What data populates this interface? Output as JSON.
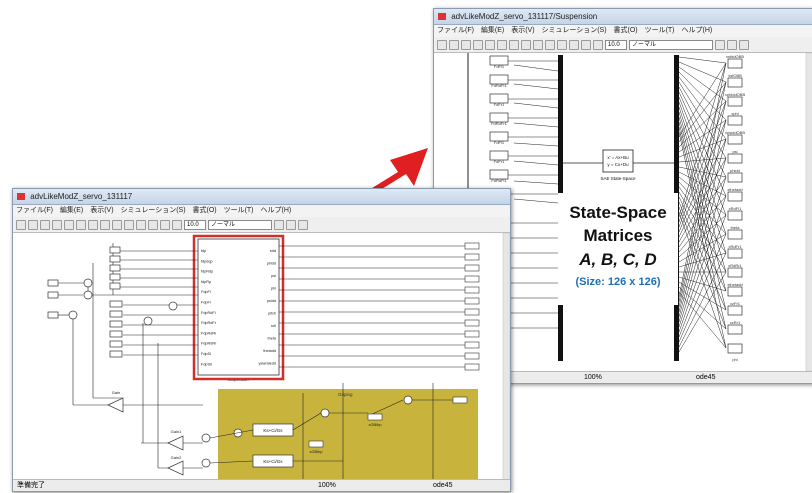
{
  "window_back": {
    "title": "advLikeModZ_servo_131117/Suspension",
    "menu": [
      "ファイル(F)",
      "編集(E)",
      "表示(V)",
      "シミュレーション(S)",
      "書式(O)",
      "ツール(T)",
      "ヘルプ(H)"
    ],
    "sim_time": "10.0",
    "mode": "ノーマル",
    "status_zoom": "100%",
    "status_solver": "ode45",
    "left_blocks": [
      "FdFl1",
      "FdRdFl1",
      "FdFr1",
      "FdRdFr1",
      "FdFl1",
      "FdFr1",
      "FdRdFl1",
      "FdRdFr1"
    ],
    "right_blocks": [
      "xsfddOBB",
      "xsfOBB",
      "xphiddOBB",
      "xphi",
      "xpsiddOBB",
      "psi",
      "phidd",
      "xthetadd",
      "xRdFl1",
      "theta",
      "xRdFr1",
      "xRdRr1",
      "xthetadd",
      "xzFr1",
      "xzRr1",
      "phi"
    ],
    "ss_block_line1": "x' = Ax+Bu",
    "ss_block_line2": "y = Cx+Du",
    "ss_block_caption": "SAE State-Space",
    "callout_title_1": "State-Space",
    "callout_title_2": "Matrices",
    "callout_abcd": "A, B, C, D",
    "callout_size": "(Size: 126 x 126)"
  },
  "window_front": {
    "title": "advLikeModZ_servo_131117",
    "menu": [
      "ファイル(F)",
      "編集(E)",
      "表示(V)",
      "シミュレーション(S)",
      "書式(O)",
      "ツール(T)",
      "ヘルプ(H)"
    ],
    "sim_time": "10.0",
    "mode": "ノーマル",
    "status_left": "準備完了",
    "status_zoom": "100%",
    "status_solver": "ode45",
    "subsystem_caption": "Suspension",
    "subsystem_inputs": [
      "fdp",
      "fdpdqp",
      "fdpRdp",
      "fdpRp",
      "FdpFl",
      "FdpFr",
      "FdpRdFl",
      "FdpRdFr",
      "FdpRdRl",
      "FdpRdRr",
      "FdpSI",
      "FdpSII"
    ],
    "subsystem_outputs": [
      "sdd",
      "phidd",
      "psi",
      "phi",
      "psidd",
      "pitch",
      "roll",
      "theta",
      "thetadd",
      "yawratedd"
    ],
    "tf_block_1": "Ks+Ci/Gs",
    "tf_block_2": "Ks+Ci/Gs",
    "gain_labels": [
      "Gain",
      "Gain1",
      "Gain2"
    ],
    "highlight_label": "Griping",
    "highlight_out_1": "xGBlbp",
    "highlight_out_2": "xGBlbp"
  },
  "colors": {
    "highlight_box": "#d32e2a",
    "arrow": "#e02020",
    "yellow_region": "#c8b43c",
    "size_text": "#1f6fb5"
  }
}
